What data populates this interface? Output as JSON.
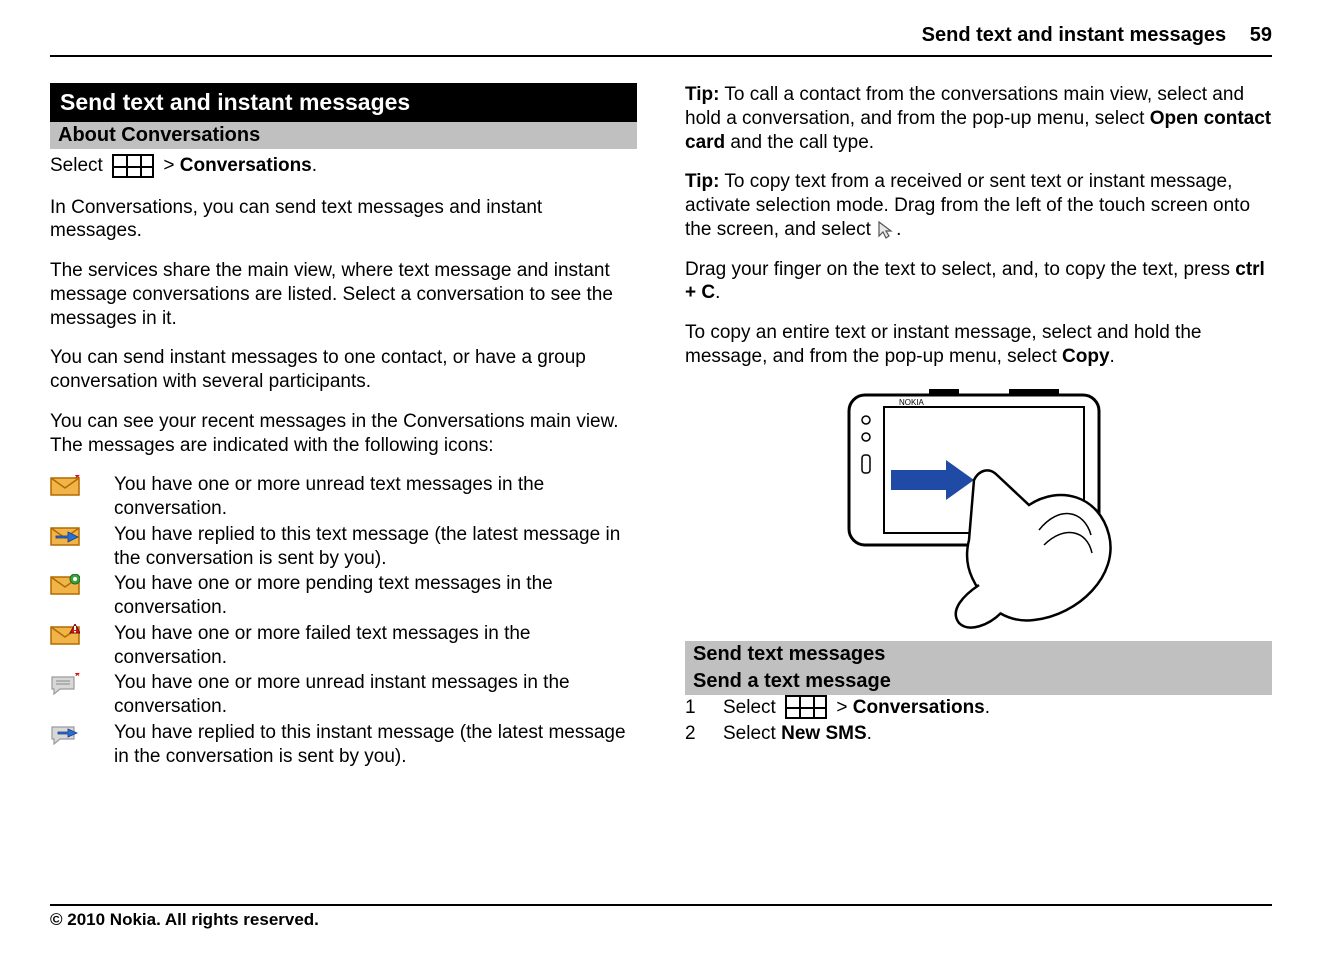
{
  "header": {
    "title": "Send text and instant messages",
    "page_number": "59"
  },
  "footer": {
    "copyright": "© 2010 Nokia. All rights reserved."
  },
  "left": {
    "section_heading": "Send text and instant messages",
    "sub_heading": "About Conversations",
    "select_word": "Select",
    "select_sep": ">",
    "select_target": "Conversations",
    "select_dot": ".",
    "p1": "In Conversations, you can send text messages and instant messages.",
    "p2": "The services share the main view, where text message and instant message conversations are listed. Select a conversation to see the messages in it.",
    "p3": "You can send instant messages to one contact, or have a group conversation with several participants.",
    "p4": "You can see your recent messages in the Conversations main view. The messages are indicated with the following icons:",
    "icons": [
      {
        "name": "unread-sms-icon",
        "text": "You have one or more unread text messages in the conversation."
      },
      {
        "name": "replied-sms-icon",
        "text": "You have replied to this text message (the latest message in the conversation is sent by you)."
      },
      {
        "name": "pending-sms-icon",
        "text": "You have one or more pending text messages in the conversation."
      },
      {
        "name": "failed-sms-icon",
        "text": "You have one or more failed text messages in the conversation."
      },
      {
        "name": "unread-im-icon",
        "text": "You have one or more unread instant messages in the conversation."
      },
      {
        "name": "replied-im-icon",
        "text": "You have replied to this instant message (the latest message in the conversation is sent by you)."
      }
    ]
  },
  "right": {
    "tip1_label": "Tip:",
    "tip1_a": " To call a contact from the conversations main view, select and hold a conversation, and from the pop-up menu, select ",
    "tip1_bold": "Open contact card",
    "tip1_b": " and the call type.",
    "tip2_label": "Tip:",
    "tip2_a": " To copy text from a received or sent text or instant message, activate selection mode. Drag from the left of the touch screen onto the screen, and select ",
    "tip2_end": ".",
    "drag_a": "Drag your finger on the text to select, and, to copy the text, press ",
    "drag_bold": "ctrl + C",
    "drag_b": ".",
    "copy_a": "To copy an entire text or instant message, select and hold the message, and from the pop-up menu, select ",
    "copy_bold": "Copy",
    "copy_b": ".",
    "send_heading1": "Send text messages",
    "send_heading2": "Send a text message",
    "step1_num": "1",
    "step1_select": "Select",
    "step1_sep": ">",
    "step1_target": "Conversations",
    "step1_dot": ".",
    "step2_num": "2",
    "step2_a": "Select ",
    "step2_bold": "New SMS",
    "step2_b": "."
  }
}
